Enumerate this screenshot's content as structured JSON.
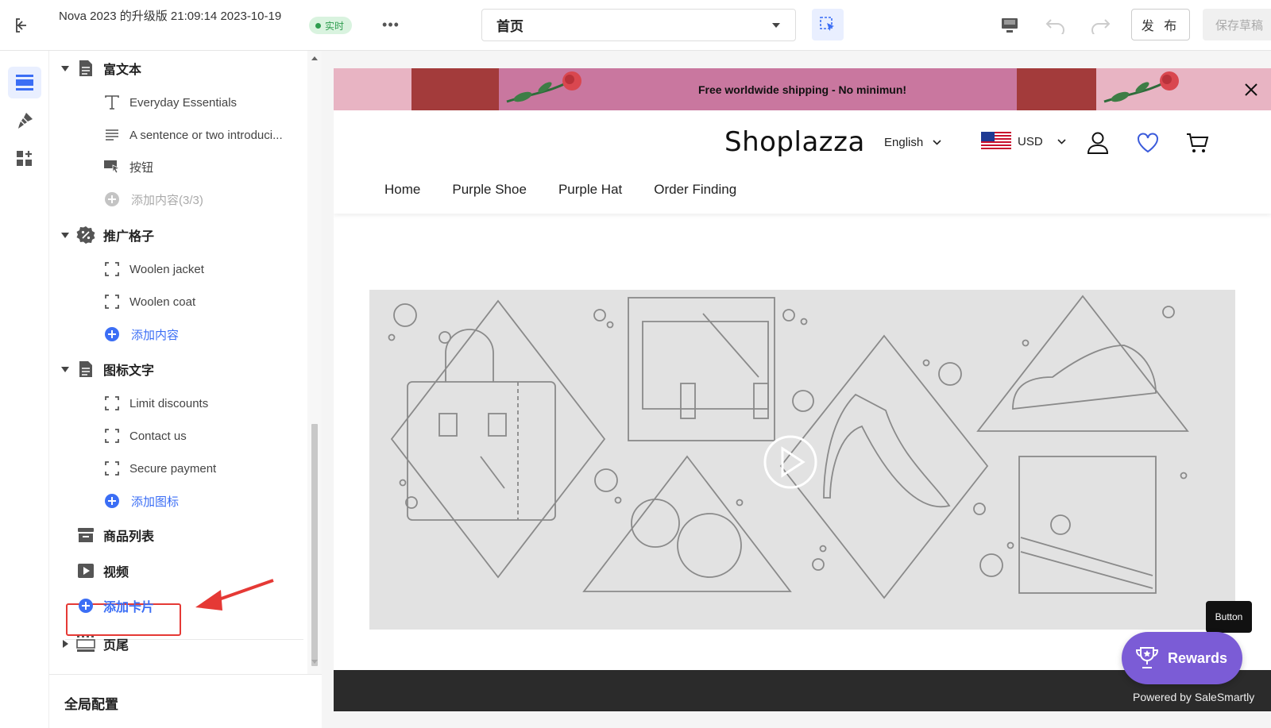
{
  "topbar": {
    "theme_title": "Nova 2023 的升级版 21:09:14 2023-10-19",
    "live_badge": "实时",
    "more": "•••",
    "page_select": "首页",
    "publish_label": "发 布",
    "save_draft_label": "保存草稿"
  },
  "tree": {
    "rich_text": {
      "label": "富文本",
      "items": [
        "Everyday Essentials",
        "A sentence or two introduci...",
        "按钮"
      ],
      "add": "添加内容(3/3)"
    },
    "promo_grid": {
      "label": "推广格子",
      "items": [
        "Woolen jacket",
        "Woolen coat"
      ],
      "add": "添加内容"
    },
    "icon_text": {
      "label": "图标文字",
      "items": [
        "Limit discounts",
        "Contact us",
        "Secure payment"
      ],
      "add": "添加图标"
    },
    "product_list": "商品列表",
    "video": "视频",
    "add_card": "添加卡片",
    "footer": "页尾"
  },
  "global_config": "全局配置",
  "preview": {
    "announcement": "Free worldwide shipping - No minimun!",
    "logo": "Shoplazza",
    "language": "English",
    "currency": "USD",
    "nav": [
      "Home",
      "Purple Shoe",
      "Purple Hat",
      "Order Finding"
    ]
  },
  "widget": {
    "tooltip": "Button",
    "rewards": "Rewards",
    "powered_by": "Powered by SaleSmartly"
  },
  "colors": {
    "accent": "#3b6ef5",
    "live_green": "#2f9d4f",
    "annotation_red": "#e53935",
    "rewards_purple": "#7b5cd6",
    "announcement_pink": "#c9779f"
  }
}
